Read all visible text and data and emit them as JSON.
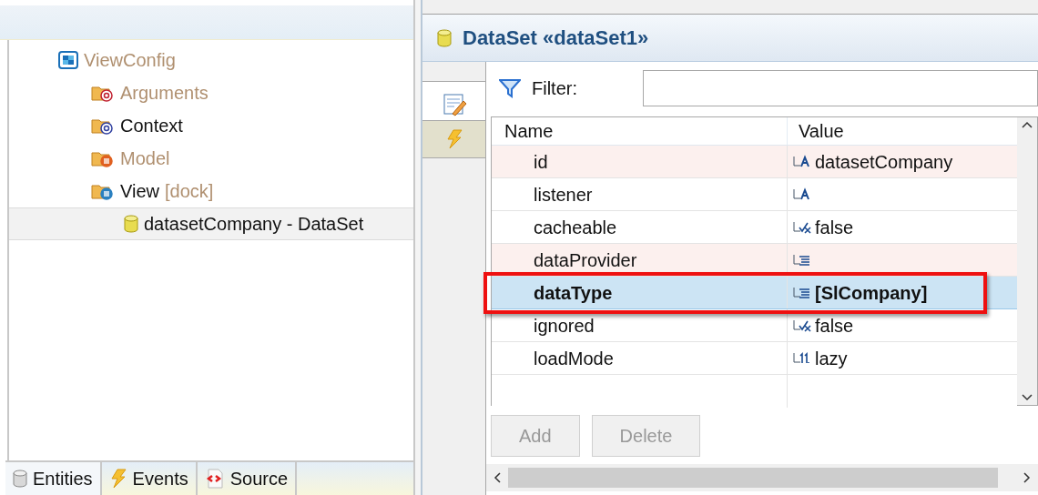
{
  "tree": [
    {
      "label": "ViewConfig",
      "kind": "config",
      "dimmed": true,
      "selected": false,
      "children": [
        {
          "label": "Arguments",
          "kind": "args-folder",
          "dimmed": true,
          "selected": false
        },
        {
          "label": "Context",
          "kind": "context-folder",
          "dimmed": false,
          "selected": false
        },
        {
          "label": "Model",
          "kind": "model-folder",
          "dimmed": true,
          "selected": false
        },
        {
          "label": "View",
          "suffix": "[dock]",
          "kind": "view-folder",
          "dimmed": false,
          "selected": false,
          "children": [
            {
              "label": "datasetCompany - DataSet",
              "kind": "dataset",
              "dimmed": false,
              "selected": true
            }
          ]
        }
      ]
    }
  ],
  "bottom_tabs": [
    {
      "label": "Entities",
      "kind": "entities",
      "selected": true
    },
    {
      "label": "Events",
      "kind": "events",
      "selected": false
    },
    {
      "label": "Source",
      "kind": "source",
      "selected": false
    }
  ],
  "editor": {
    "title": "DataSet «dataSet1»",
    "side_tabs": [
      {
        "kind": "properties",
        "selected": true
      },
      {
        "kind": "events",
        "selected": false
      }
    ],
    "filter": {
      "label": "Filter:"
    },
    "table": {
      "columns": [
        "Name",
        "Value"
      ],
      "rows": [
        {
          "name": "id",
          "kind": "text",
          "value": "datasetCompany",
          "tinted": true,
          "selected": false,
          "highlighted": false
        },
        {
          "name": "listener",
          "kind": "text",
          "tinted": false,
          "selected": false,
          "highlighted": false
        },
        {
          "name": "cacheable",
          "kind": "boolean",
          "value": "false",
          "tinted": false,
          "selected": false,
          "highlighted": false
        },
        {
          "name": "dataProvider",
          "kind": "list",
          "tinted": true,
          "selected": false,
          "highlighted": false
        },
        {
          "name": "dataType",
          "kind": "list",
          "value": "[SlCompany]",
          "tinted": false,
          "selected": true,
          "highlighted": true
        },
        {
          "name": "ignored",
          "kind": "boolean",
          "value": "false",
          "tinted": false,
          "selected": false,
          "highlighted": false
        },
        {
          "name": "loadMode",
          "kind": "number",
          "value": "lazy",
          "tinted": false,
          "selected": false,
          "highlighted": false
        }
      ]
    },
    "buttons": [
      {
        "label": "Add",
        "disabled": true
      },
      {
        "label": "Delete",
        "disabled": true
      }
    ]
  }
}
